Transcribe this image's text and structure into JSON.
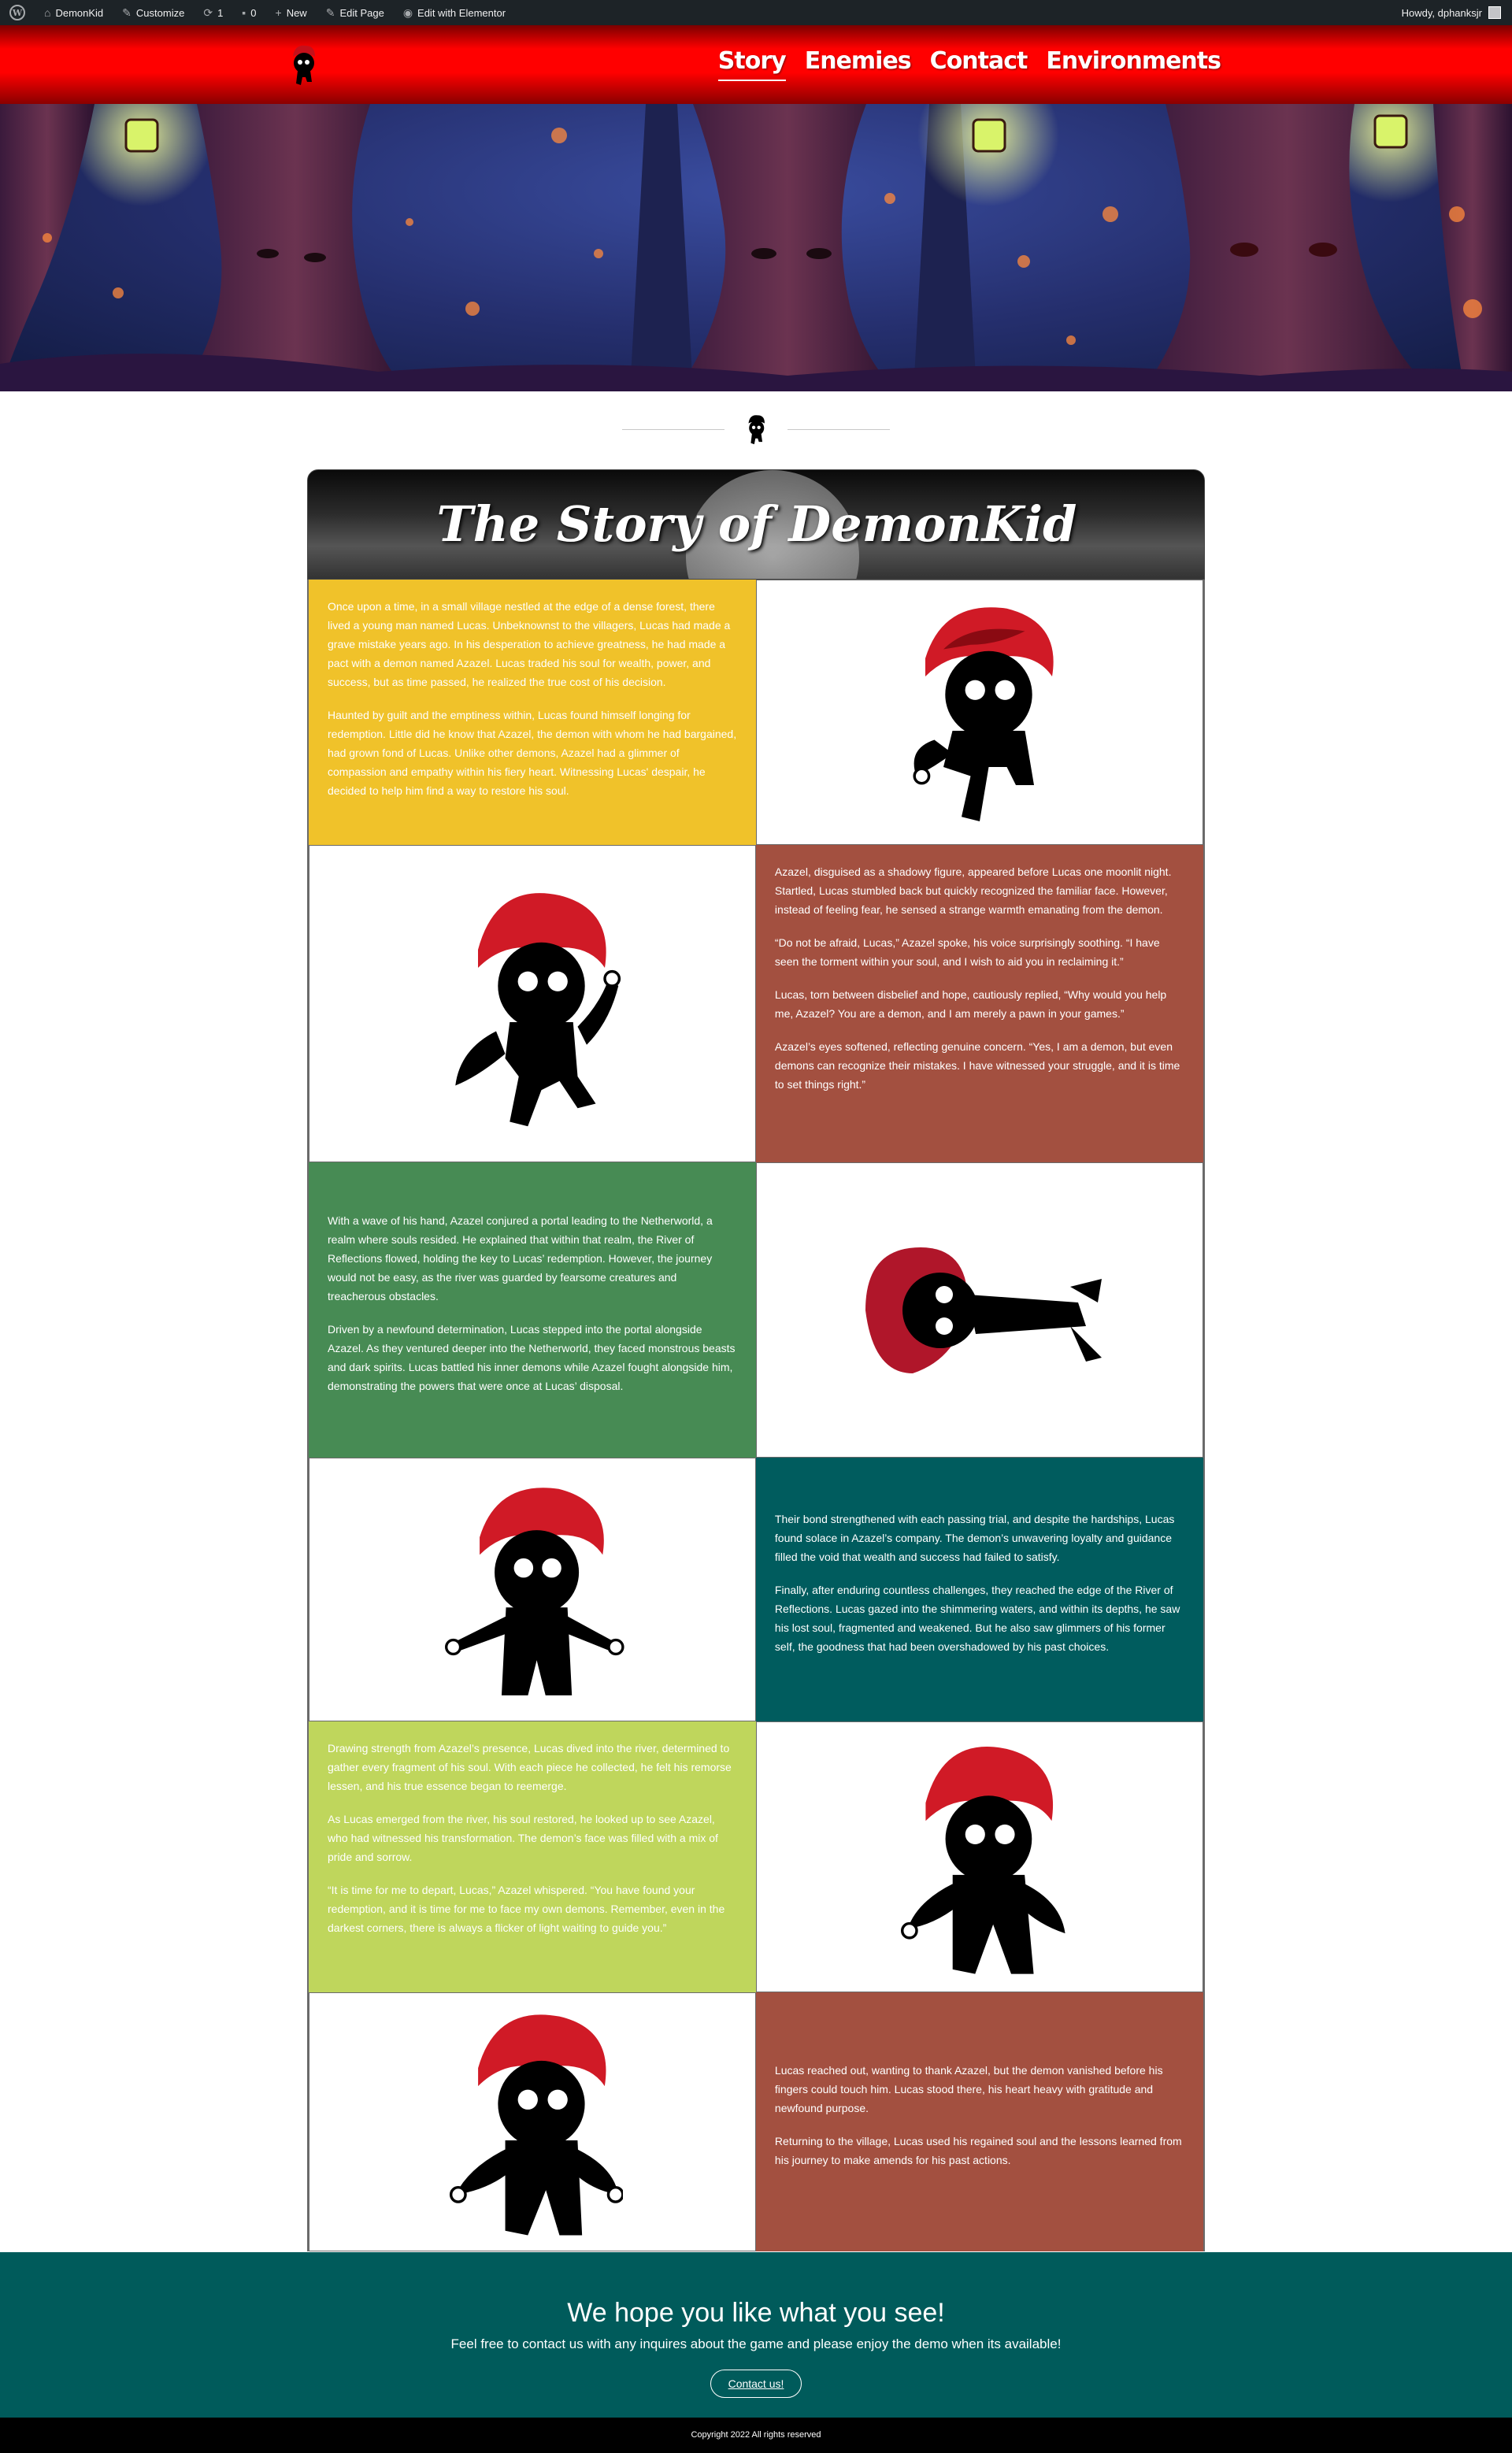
{
  "admin_bar": {
    "site_name": "DemonKid",
    "customize": "Customize",
    "updates_count": "1",
    "comments_count": "0",
    "new": "New",
    "edit_page": "Edit Page",
    "edit_elementor": "Edit with Elementor",
    "howdy": "Howdy, dphanksjr"
  },
  "nav": {
    "items": [
      "Story",
      "Enemies",
      "Contact",
      "Environments"
    ],
    "active": "Story"
  },
  "story": {
    "title": "The Story of DemonKid",
    "blocks": [
      {
        "color": "#f0c22a",
        "paragraphs": [
          "Once upon a time, in a small village nestled at the edge of a dense forest, there lived a young man named Lucas. Unbeknownst to the villagers, Lucas had made a grave mistake years ago. In his desperation to achieve greatness, he had made a pact with a demon named Azazel. Lucas traded his soul for wealth, power, and success, but as time passed, he realized the true cost of his decision.",
          "Haunted by guilt and the emptiness within, Lucas found himself longing for redemption. Little did he know that Azazel, the demon with whom he had bargained, had grown fond of Lucas. Unlike other demons, Azazel had a glimmer of compassion and empathy within his fiery heart. Witnessing Lucas' despair, he decided to help him find a way to restore his soul."
        ]
      },
      {
        "color": "#a35040",
        "paragraphs": [
          "Azazel, disguised as a shadowy figure, appeared before Lucas one moonlit night. Startled, Lucas stumbled back but quickly recognized the familiar face. However, instead of feeling fear, he sensed a strange warmth emanating from the demon.",
          "“Do not be afraid, Lucas,” Azazel spoke, his voice surprisingly soothing. “I have seen the torment within your soul, and I wish to aid you in reclaiming it.”",
          "Lucas, torn between disbelief and hope, cautiously replied, “Why would you help me, Azazel? You are a demon, and I am merely a pawn in your games.”",
          "Azazel’s eyes softened, reflecting genuine concern. “Yes, I am a demon, but even demons can recognize their mistakes. I have witnessed your struggle, and it is time to set things right.”"
        ]
      },
      {
        "color": "#478b54",
        "paragraphs": [
          "With a wave of his hand, Azazel conjured a portal leading to the Netherworld, a realm where souls resided. He explained that within that realm, the River of Reflections flowed, holding the key to Lucas’ redemption. However, the journey would not be easy, as the river was guarded by fearsome creatures and treacherous obstacles.",
          "Driven by a newfound determination, Lucas stepped into the portal alongside Azazel. As they ventured deeper into the Netherworld, they faced monstrous beasts and dark spirits. Lucas battled his inner demons while Azazel fought alongside him, demonstrating the powers that were once at Lucas’ disposal."
        ]
      },
      {
        "color": "#005c5e",
        "paragraphs": [
          "Their bond strengthened with each passing trial, and despite the hardships, Lucas found solace in Azazel’s company. The demon’s unwavering loyalty and guidance filled the void that wealth and success had failed to satisfy.",
          "Finally, after enduring countless challenges, they reached the edge of the River of Reflections. Lucas gazed into the shimmering waters, and within its depths, he saw his lost soul, fragmented and weakened. But he also saw glimmers of his former self, the goodness that had been overshadowed by his past choices."
        ]
      },
      {
        "color": "#bfd65c",
        "paragraphs": [
          "Drawing strength from Azazel’s presence, Lucas dived into the river, determined to gather every fragment of his soul. With each piece he collected, he felt his remorse lessen, and his true essence began to reemerge.",
          "As Lucas emerged from the river, his soul restored, he looked up to see Azazel, who had witnessed his transformation. The demon’s face was filled with a mix of pride and sorrow.",
          "“It is time for me to depart, Lucas,” Azazel whispered. “You have found your redemption, and it is time for me to face my own demons. Remember, even in the darkest corners, there is always a flicker of light waiting to guide you.”"
        ]
      },
      {
        "color": "#a35040",
        "paragraphs": [
          "Lucas reached out, wanting to thank Azazel, but the demon vanished before his fingers could touch him. Lucas stood there, his heart heavy with gratitude and newfound purpose.",
          "Returning to the village, Lucas used his regained soul and the lessons learned from his journey to make amends for his past actions."
        ]
      }
    ]
  },
  "cta": {
    "heading": "We hope you like what you see!",
    "subtext": "Feel free to contact us with any inquires about the game and please enjoy the demo when its available!",
    "button": "Contact us!"
  },
  "footer": {
    "copyright": "Copyright 2022 All rights reserved"
  }
}
